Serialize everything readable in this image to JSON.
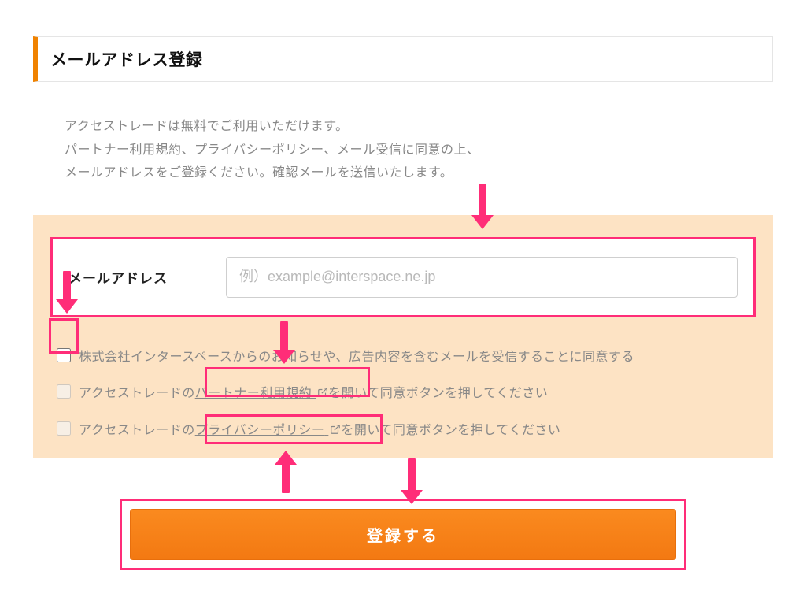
{
  "header": {
    "title": "メールアドレス登録"
  },
  "intro": {
    "line1": "アクセストレードは無料でご利用いただけます。",
    "line2": "パートナー利用規約、プライバシーポリシー、メール受信に同意の上、",
    "line3": "メールアドレスをご登録ください。確認メールを送信いたします。"
  },
  "form": {
    "email_label": "メールアドレス",
    "email_placeholder": "例）example@interspace.ne.jp"
  },
  "consents": {
    "c1": "株式会社インタースペースからのお知らせや、広告内容を含むメールを受信することに同意する",
    "c2_pre": "アクセストレードの",
    "c2_link": "パートナー利用規約",
    "c2_post": "を開いて同意ボタンを押してください",
    "c3_pre": "アクセストレードの",
    "c3_link": "プライバシーポリシー",
    "c3_post": "を開いて同意ボタンを押してください"
  },
  "submit": {
    "label": "登録する"
  },
  "colors": {
    "accent_orange": "#f08200",
    "annotation_pink": "#ff2d78",
    "panel_peach": "#fde3c4"
  }
}
